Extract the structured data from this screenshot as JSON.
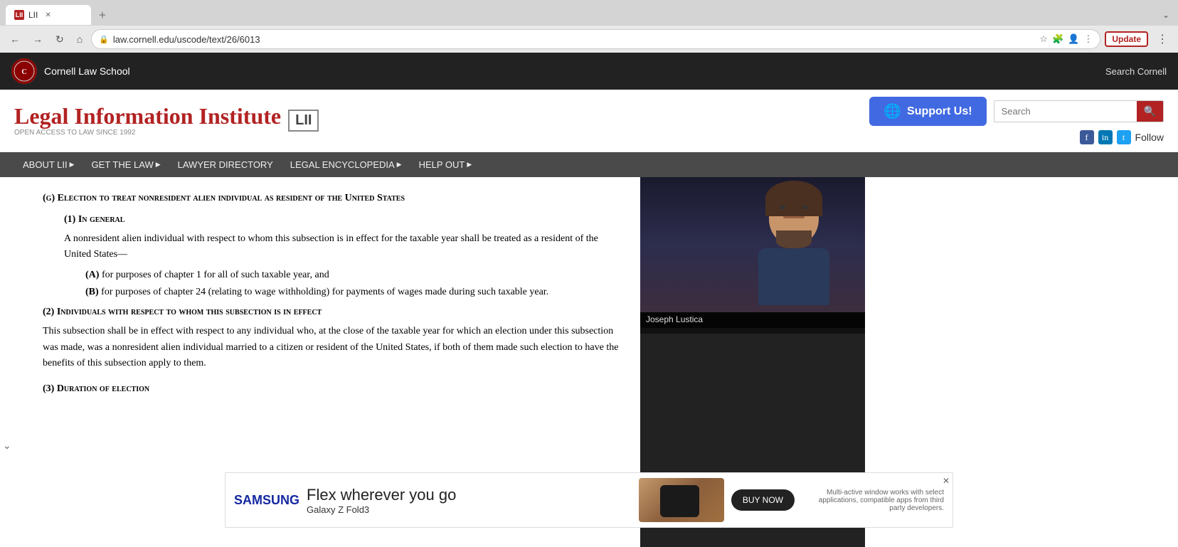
{
  "browser": {
    "address": "law.cornell.edu/uscode/text/26/6013",
    "update_label": "Update",
    "tab_label": "LII"
  },
  "cornell_header": {
    "school_name": "Cornell Law School",
    "search_label": "Search Cornell"
  },
  "lii_header": {
    "logo_text": "Legal Information Institute",
    "logo_bracket": "LII",
    "logo_subtitle": "OPEN ACCESS TO LAW SINCE 1992",
    "support_label": "Support Us!",
    "search_placeholder": "Search",
    "follow_label": "Follow"
  },
  "nav": {
    "items": [
      {
        "label": "ABOUT LII",
        "has_arrow": true
      },
      {
        "label": "GET THE LAW",
        "has_arrow": true
      },
      {
        "label": "LAWYER DIRECTORY",
        "has_arrow": false
      },
      {
        "label": "LEGAL ENCYCLOPEDIA",
        "has_arrow": true
      },
      {
        "label": "HELP OUT",
        "has_arrow": true
      }
    ]
  },
  "content": {
    "section_g_heading": "(g) Election to treat nonresident alien individual as resident of the United States",
    "sub1_heading": "(1) In general",
    "sub1_text": "A nonresident alien individual with respect to whom this subsection is in effect for the taxable year shall be treated as a resident of the United States—",
    "item_a_label": "(A)",
    "item_a_text": "for purposes of chapter 1 for all of such taxable year, and",
    "item_b_label": "(B)",
    "item_b_text": "for purposes of chapter 24 (relating to wage withholding) for payments of wages made during such taxable year.",
    "sub2_heading": "(2) Individuals with respect to whom this subsection is in effect",
    "sub2_text": "This subsection shall be in effect with respect to any individual who, at the close of the taxable year for which an election under this subsection was made, was a nonresident alien individual married to a citizen or resident of the United States, if both of them made such election to have the benefits of this subsection apply to them.",
    "sub3_heading": "(3) Duration of election"
  },
  "ad": {
    "brand": "SAMSUNG",
    "tagline": "Flex wherever you go",
    "product": "Galaxy Z Fold3",
    "cta_label": "BUY NOW",
    "fine_print": "Multi-active window works with select applications, compatible apps from third party developers."
  },
  "webcam": {
    "person_name": "Joseph Lustica"
  }
}
